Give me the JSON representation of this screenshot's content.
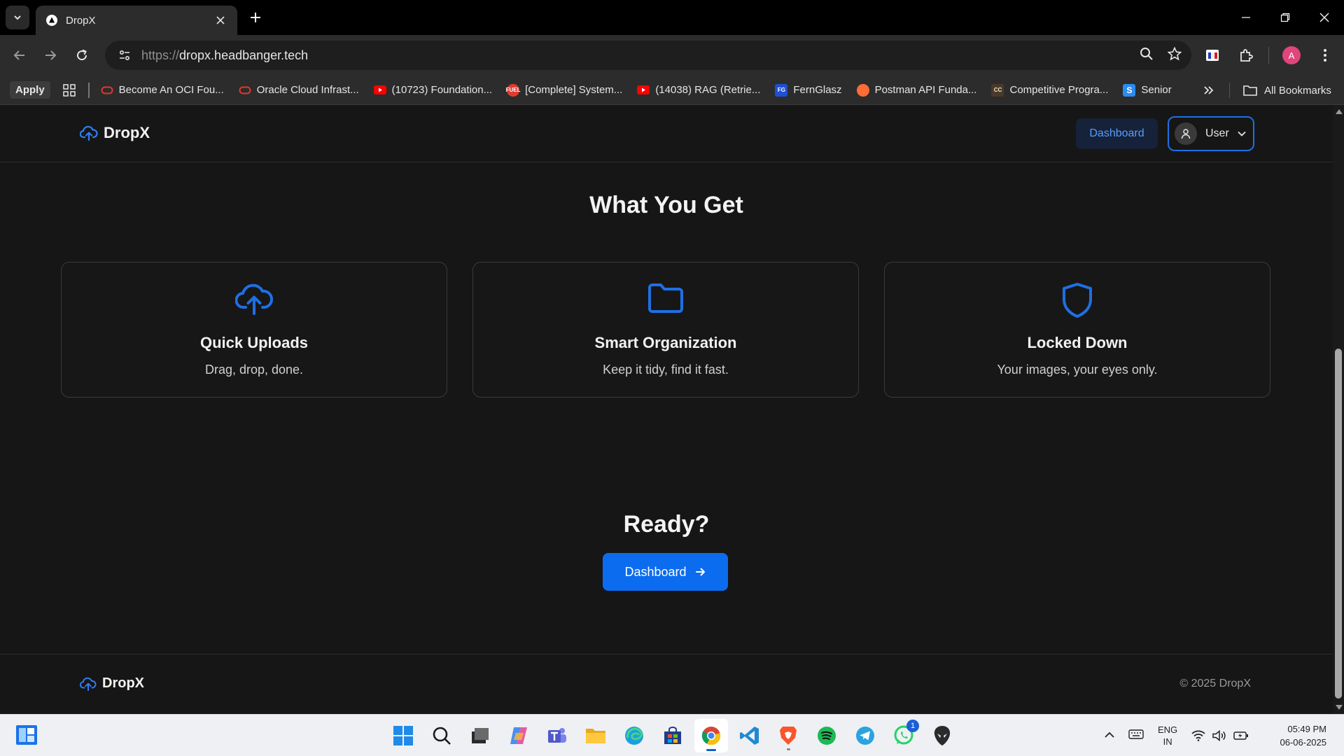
{
  "browser": {
    "tab_title": "DropX",
    "url_scheme": "https://",
    "url_host": "dropx.headbanger.tech",
    "profile_initial": "A",
    "bookmarks": {
      "apply_label": "Apply",
      "items": [
        {
          "label": "Become An OCI Fou...",
          "icon": "oracle-icon"
        },
        {
          "label": "Oracle Cloud Infrast...",
          "icon": "oracle-icon"
        },
        {
          "label": "(10723) Foundation...",
          "icon": "youtube-icon"
        },
        {
          "label": "[Complete] System...",
          "icon": "fuel-icon"
        },
        {
          "label": "(14038) RAG (Retrie...",
          "icon": "youtube-icon"
        },
        {
          "label": "FernGlasz",
          "icon": "fg-icon"
        },
        {
          "label": "Postman API Funda...",
          "icon": "postman-icon"
        },
        {
          "label": "Competitive Progra...",
          "icon": "cc-icon"
        },
        {
          "label": "Senior",
          "icon": "s-icon"
        }
      ],
      "all_bookmarks_label": "All Bookmarks"
    }
  },
  "site": {
    "brand": "DropX",
    "header": {
      "dashboard_label": "Dashboard",
      "user_label": "User"
    },
    "features": {
      "title": "What You Get",
      "cards": [
        {
          "title": "Quick Uploads",
          "description": "Drag, drop, done.",
          "icon": "cloud-upload-icon"
        },
        {
          "title": "Smart Organization",
          "description": "Keep it tidy, find it fast.",
          "icon": "folder-icon"
        },
        {
          "title": "Locked Down",
          "description": "Your images, your eyes only.",
          "icon": "shield-icon"
        }
      ]
    },
    "cta": {
      "title": "Ready?",
      "button_label": "Dashboard"
    },
    "footer": {
      "brand": "DropX",
      "copyright": "© 2025 DropX"
    },
    "colors": {
      "accent": "#0b6cf0",
      "background": "#161616"
    }
  },
  "taskbar": {
    "language_line1": "ENG",
    "language_line2": "IN",
    "time": "05:49 PM",
    "date": "06-06-2025",
    "whatsapp_badge": "1"
  }
}
